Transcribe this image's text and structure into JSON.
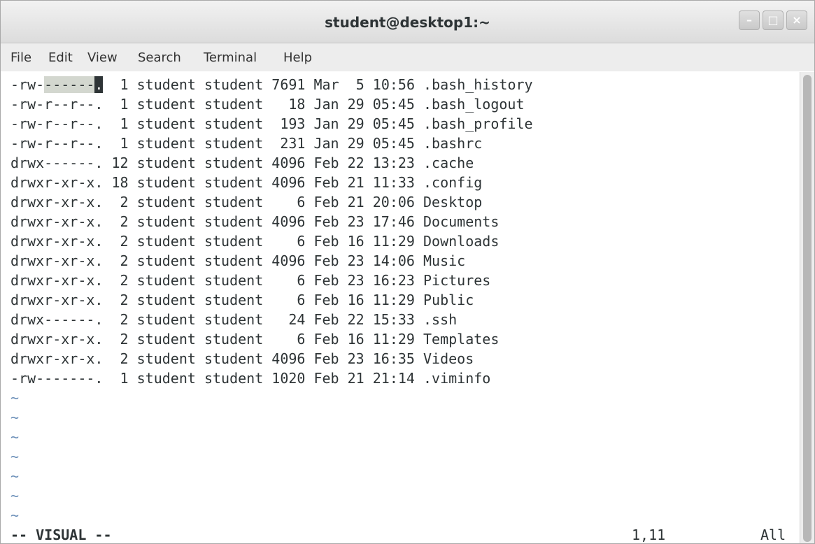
{
  "window": {
    "title": "student@desktop1:~",
    "controls": [
      "–",
      "□",
      "×"
    ]
  },
  "menu": [
    "File",
    "Edit",
    "View",
    "Search",
    "Terminal",
    "Help"
  ],
  "first_line": {
    "perm_start": "-rw-",
    "perm_sel": "------",
    "perm_cursor": ".",
    "rest": "  1 student student 7691 Mar  5 10:56 .bash_history"
  },
  "lines": [
    "-rw-r--r--.  1 student student   18 Jan 29 05:45 .bash_logout",
    "-rw-r--r--.  1 student student  193 Jan 29 05:45 .bash_profile",
    "-rw-r--r--.  1 student student  231 Jan 29 05:45 .bashrc",
    "drwx------. 12 student student 4096 Feb 22 13:23 .cache",
    "drwxr-xr-x. 18 student student 4096 Feb 21 11:33 .config",
    "drwxr-xr-x.  2 student student    6 Feb 21 20:06 Desktop",
    "drwxr-xr-x.  2 student student 4096 Feb 23 17:46 Documents",
    "drwxr-xr-x.  2 student student    6 Feb 16 11:29 Downloads",
    "drwxr-xr-x.  2 student student 4096 Feb 23 14:06 Music",
    "drwxr-xr-x.  2 student student    6 Feb 23 16:23 Pictures",
    "drwxr-xr-x.  2 student student    6 Feb 16 11:29 Public",
    "drwx------.  2 student student   24 Feb 22 15:33 .ssh",
    "drwxr-xr-x.  2 student student    6 Feb 16 11:29 Templates",
    "drwxr-xr-x.  2 student student 4096 Feb 23 16:35 Videos",
    "-rw-------.  1 student student 1020 Feb 21 21:14 .viminfo"
  ],
  "tildes": [
    "~",
    "~",
    "~",
    "~",
    "~",
    "~",
    "~"
  ],
  "status": {
    "mode": "-- VISUAL --",
    "position": "1,11",
    "scroll": "All"
  }
}
